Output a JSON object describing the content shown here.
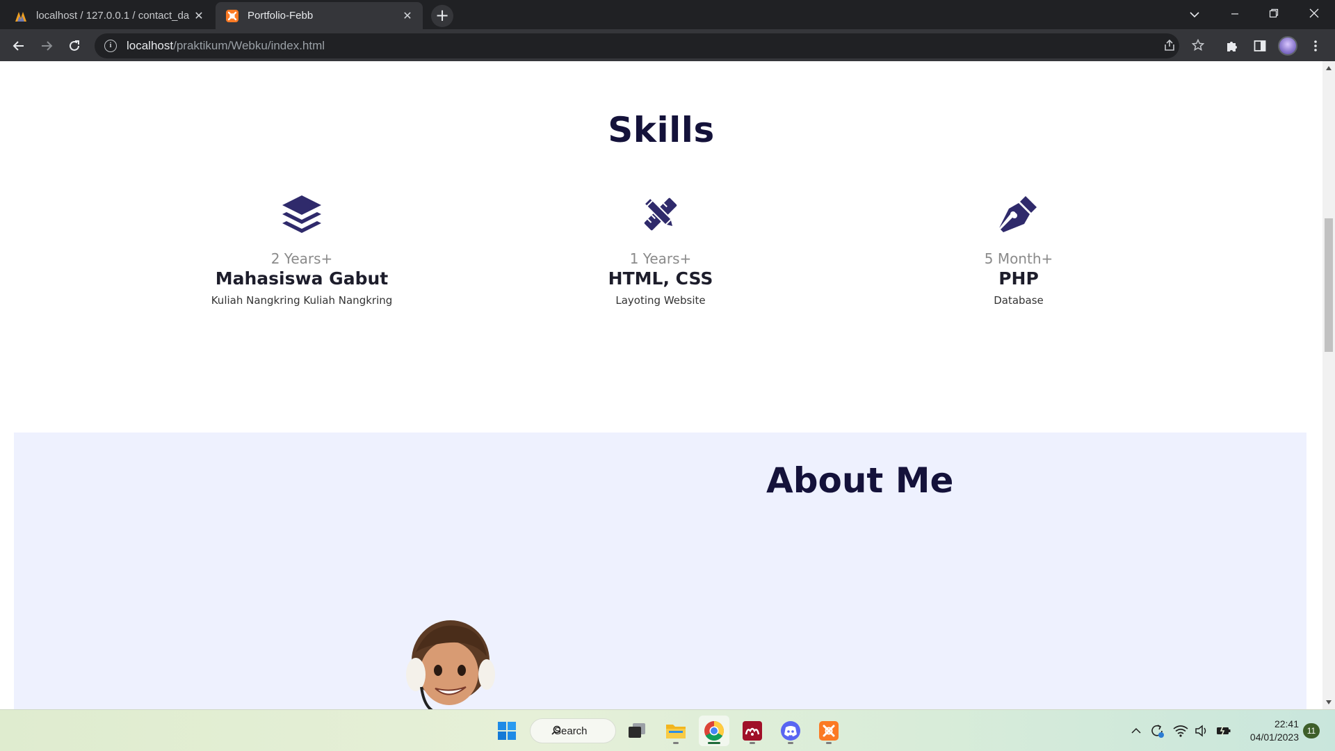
{
  "browser": {
    "tabs": [
      {
        "title": "localhost / 127.0.0.1 / contact_da",
        "favicon": "phpmyadmin-icon",
        "active": false
      },
      {
        "title": "Portfolio-Febb",
        "favicon": "xampp-icon",
        "active": true
      }
    ],
    "url_host": "localhost",
    "url_path": "/praktikum/Webku/index.html"
  },
  "page": {
    "skills_title": "Skills",
    "skills": [
      {
        "icon": "layers-icon",
        "duration": "2 Years+",
        "name": "Mahasiswa Gabut",
        "desc": "Kuliah Nangkring Kuliah Nangkring"
      },
      {
        "icon": "pencil-ruler-icon",
        "duration": "1 Years+",
        "name": "HTML, CSS",
        "desc": "Layoting Website"
      },
      {
        "icon": "pen-nib-icon",
        "duration": "5 Month+",
        "name": "PHP",
        "desc": "Database"
      }
    ],
    "about_title": "About Me"
  },
  "taskbar": {
    "search_label": "Search",
    "time": "22:41",
    "date": "04/01/2023",
    "notification_count": "11",
    "apps": [
      "start-icon",
      "task-view-icon",
      "file-explorer-icon",
      "chrome-icon",
      "mendeley-icon",
      "discord-icon",
      "xampp-icon"
    ]
  },
  "colors": {
    "heading": "#14123a",
    "icon": "#2f2a6b",
    "about_bg": "#eef1fe",
    "chrome_dark": "#202124"
  }
}
